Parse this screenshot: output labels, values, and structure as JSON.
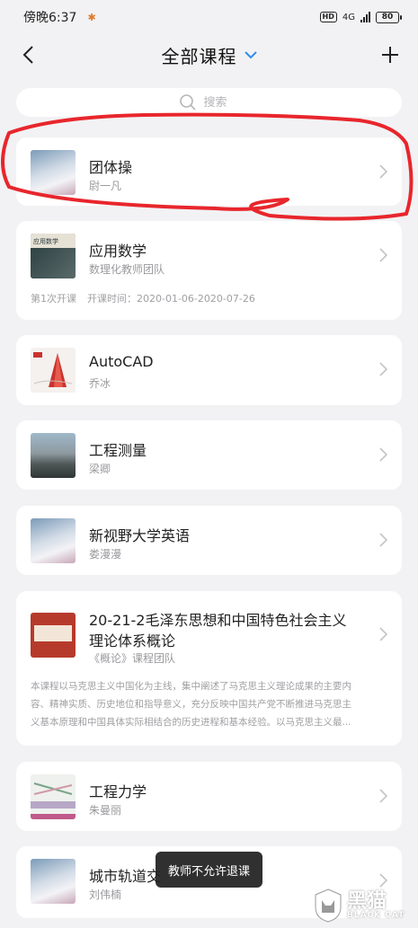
{
  "status": {
    "time": "傍晚6:37",
    "network": "4G",
    "battery": "80",
    "hd": "HD"
  },
  "navbar": {
    "title": "全部课程"
  },
  "search": {
    "placeholder": "搜索"
  },
  "courses": [
    {
      "title": "团体操",
      "teacher": "尉一凡",
      "thumb": "generic"
    },
    {
      "title": "应用数学",
      "teacher": "数理化教师团队",
      "thumb": "book",
      "thumb_text": "应用数学",
      "session": "第1次开课",
      "time": "开课时间：2020-01-06-2020-07-26"
    },
    {
      "title": "AutoCAD",
      "teacher": "乔冰",
      "thumb": "cad"
    },
    {
      "title": "工程测量",
      "teacher": "梁卿",
      "thumb": "survey"
    },
    {
      "title": "新视野大学英语",
      "teacher": "娄漫漫",
      "thumb": "generic"
    },
    {
      "title_line1": "20-21-2毛泽东思想和中国特色社会主义",
      "title_line2": "理论体系概论",
      "teacher": "《概论》课程团队",
      "thumb": "red",
      "desc_line1": "本课程以马克思主义中国化为主线，集中阐述了马克思主义理论成果的主要内",
      "desc_line2": "容、精神实质、历史地位和指导意义，充分反映中国共产党不断推进马克思主",
      "desc_line3": "义基本原理和中国具体实际相结合的历史进程和基本经验。以马克思主义最..."
    },
    {
      "title": "工程力学",
      "teacher": "朱曼丽",
      "thumb": "mech"
    },
    {
      "title": "城市轨道交",
      "teacher": "刘伟楠",
      "thumb": "generic"
    }
  ],
  "toast": "教师不允许退课",
  "watermark": {
    "cn": "黑猫",
    "en": "BLACK CAT"
  },
  "colors": {
    "background": "#f2f2f4",
    "accent_blue": "#2f8ef0",
    "annotation_red": "#e8262c"
  }
}
